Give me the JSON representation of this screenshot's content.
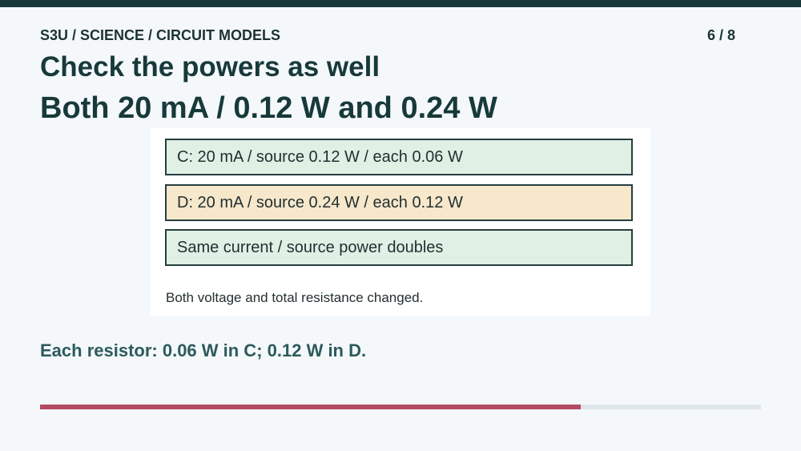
{
  "header": {
    "breadcrumb": "S3U / SCIENCE / CIRCUIT MODELS",
    "page_counter": "6 / 8"
  },
  "slide": {
    "title": "Check the powers as well",
    "subtitle": "Both 20 mA / 0.12 W and 0.24 W"
  },
  "card": {
    "options": [
      "C: 20 mA / source 0.12 W / each 0.06 W",
      "D: 20 mA / source 0.24 W / each 0.12 W",
      "Same current / source power doubles"
    ],
    "note": "Both voltage and total resistance changed."
  },
  "conclusion": "Each resistor: 0.06 W in C; 0.12 W in D.",
  "progress": {
    "current": 6,
    "total": 8,
    "fraction": 0.75
  },
  "colors": {
    "top_bar": "#17393a",
    "option_green": "#e0f0e4",
    "option_tan": "#f7e7cb",
    "progress_fill": "#b44b62",
    "progress_track": "#dfe6ea"
  }
}
